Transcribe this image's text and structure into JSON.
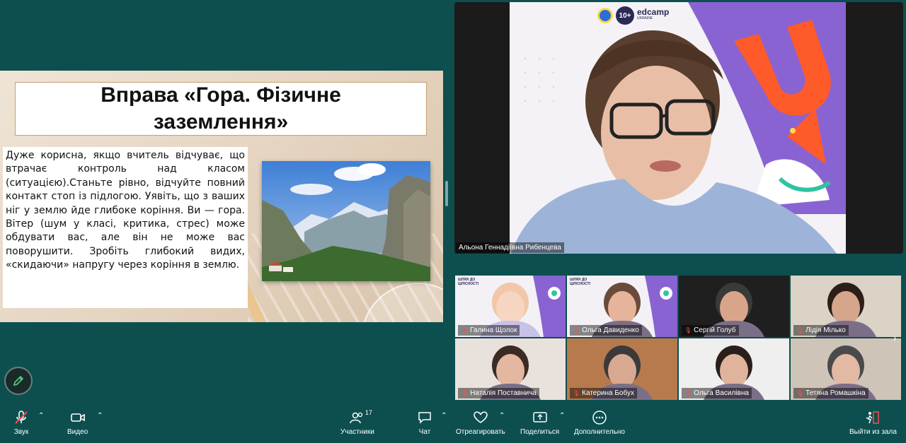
{
  "slide": {
    "title": "Вправа «Гора. Фізичне заземлення»",
    "text": "Дуже корисна, якщо вчитель відчуває, що втрачає контроль над класом (ситуацією).Станьте рівно, відчуйте повний контакт стоп із підлогою. Уявіть, що з ваших ніг у землю йде глибоке коріння. Ви — гора. Вітер (шум у класі, критика, стрес) може обдувати вас, але він не може вас поворушити. Зробіть глибокий видих, «скидаючи» напругу через коріння в землю."
  },
  "speaker": {
    "name": "Альона Геннадіївна Рибенцева",
    "banner_logo_10": "10+",
    "banner_logo_text": "edcamp",
    "banner_logo_sub": "UKRAINE"
  },
  "gallery": {
    "participants": [
      {
        "name": "Галина Щолок",
        "logo": "ШЛЯХ ДО ЦІЛІСНОСТІ"
      },
      {
        "name": "Ольга Давиденко",
        "logo": "ШЛЯХ ДО ЦІЛІСНОСТІ"
      },
      {
        "name": "Сергій Голуб",
        "logo": ""
      },
      {
        "name": "Лідія Мілько",
        "logo": ""
      },
      {
        "name": "Наталія Поставнича",
        "logo": ""
      },
      {
        "name": "Катерина Бобух",
        "logo": ""
      },
      {
        "name": "Ольга Василівна",
        "logo": ""
      },
      {
        "name": "Тетяна Ромашкіна",
        "logo": ""
      }
    ]
  },
  "toolbar": {
    "sound": "Звук",
    "video": "Видео",
    "participants": "Участники",
    "participants_count": "17",
    "chat": "Чат",
    "react": "Отреагировать",
    "share": "Поделиться",
    "more": "Дополнительно",
    "leave": "Выйти из зала"
  },
  "colors": {
    "background": "#0d4f4f",
    "mic_off": "#ff4d4d",
    "accent_orange": "#ff5a2a",
    "accent_purple": "#8a63d2"
  }
}
